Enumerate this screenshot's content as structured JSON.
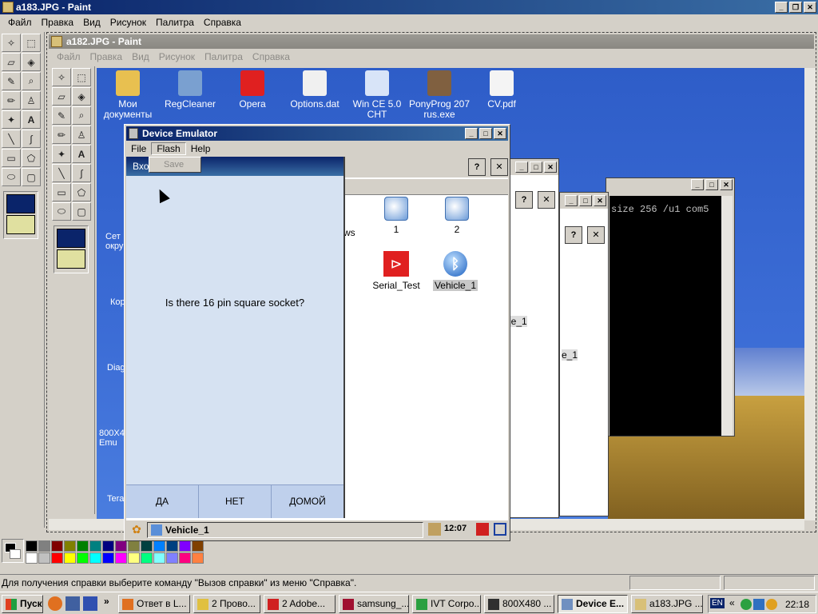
{
  "outer": {
    "title": "a183.JPG - Paint",
    "menu": [
      "Файл",
      "Правка",
      "Вид",
      "Рисунок",
      "Палитра",
      "Справка"
    ],
    "status": "Для получения справки выберите команду \"Вызов справки\" из меню \"Справка\"."
  },
  "inner": {
    "title": "a182.JPG - Paint",
    "menu": [
      "Файл",
      "Правка",
      "Вид",
      "Рисунок",
      "Палитра",
      "Справка"
    ]
  },
  "desktop_icons": [
    {
      "label": "Мои документы",
      "color": "#e8c050"
    },
    {
      "label": "RegCleaner",
      "color": "#7aa0d0"
    },
    {
      "label": "Opera",
      "color": "#e02020"
    },
    {
      "label": "Options.dat",
      "color": "#f0f0f0"
    },
    {
      "label": "Win CE 5.0 CHT",
      "color": "#d8e4f8"
    },
    {
      "label": "PonyProg 207 rus.exe",
      "color": "#806040"
    },
    {
      "label": "CV.pdf",
      "color": "#f4f4f4"
    }
  ],
  "left_partial": [
    "Сет окру",
    "Кор",
    "Diag",
    "800X4 Emu",
    "Tera"
  ],
  "emulator": {
    "title": "Device Emulator",
    "menu": [
      "File",
      "Flash",
      "Help"
    ],
    "flash_item": "Save",
    "dialog_title": "Вход",
    "question": "Is there 16 pin square socket?",
    "buttons": [
      "ДА",
      "НЕТ",
      "ДОМОЙ"
    ],
    "ce_task": "Vehicle_1",
    "ce_clock": "12:07"
  },
  "ce_icons": [
    {
      "label": "1"
    },
    {
      "label": "2"
    },
    {
      "label": "Serial_Test"
    },
    {
      "label": "Vehicle_1"
    }
  ],
  "partial_texts": {
    "ws": "ws",
    "v1a": "le_1",
    "v1b": "e_1"
  },
  "console_text": "size 256 /u1 com5",
  "taskbar": {
    "start": "Пуск",
    "items": [
      "Ответ в L...",
      "2 Прово...",
      "2 Adobe...",
      "samsung_...",
      "IVT Corpo...",
      "800X480 ...",
      "Device E...",
      "a183.JPG ..."
    ],
    "lang": "EN",
    "clock": "22:18"
  },
  "colors": {
    "titlebar_active": "#0a246a",
    "palette": [
      "#000000",
      "#808080",
      "#800000",
      "#808000",
      "#008000",
      "#008080",
      "#000080",
      "#800080",
      "#808040",
      "#004040",
      "#0080ff",
      "#004080",
      "#8000ff",
      "#804000",
      "#ffffff",
      "#c0c0c0",
      "#ff0000",
      "#ffff00",
      "#00ff00",
      "#00ffff",
      "#0000ff",
      "#ff00ff",
      "#ffff80",
      "#00ff80",
      "#80ffff",
      "#8080ff",
      "#ff0080",
      "#ff8040"
    ]
  }
}
